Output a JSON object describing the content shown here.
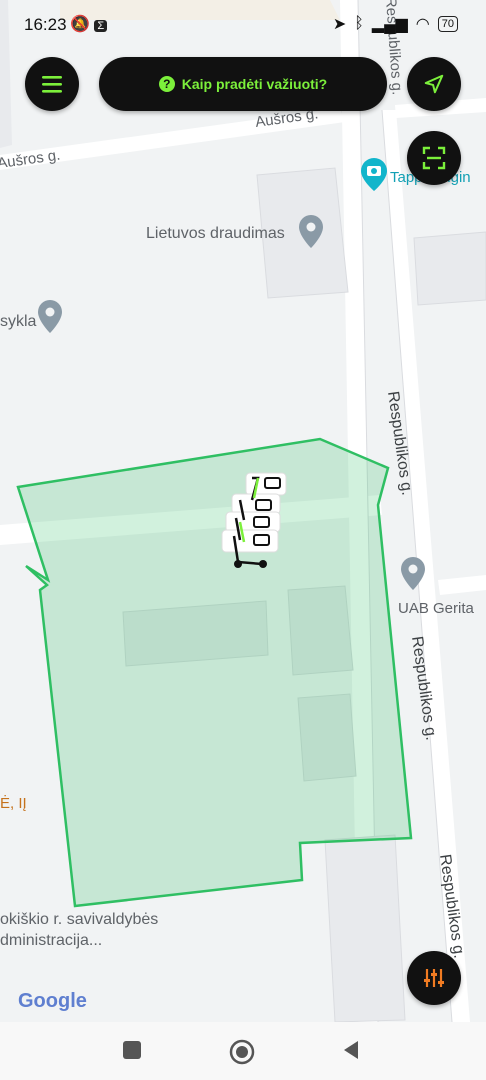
{
  "status_bar": {
    "time": "16:23",
    "battery": "70"
  },
  "header": {
    "help_label": "Kaip pradėti važiuoti?"
  },
  "map": {
    "streets": {
      "ausros_1": "Aušros g.",
      "ausros_2": "Aušros g.",
      "respublikos_top": "Respublikos g.",
      "respublikos_mid": "Respublikos g.",
      "respublikos_lower": "Respublikos g.",
      "respublikos_bottom": "Respublikos g."
    },
    "places": {
      "tapp": "Tapp Tangin",
      "lietuvos_draudimas": "Lietuvos draudimas",
      "sykla": "sykla",
      "uab_gerita": "UAB Gerita",
      "orange_label": "Ė, IĮ",
      "savivaldybe_line1": "okiškio r. savivaldybės",
      "savivaldybe_line2": "dministracija..."
    },
    "google_logo": "Google",
    "zone_color": "#2fbf63",
    "accent_color": "#7cf03b"
  },
  "icons": {
    "menu": "menu-icon",
    "help": "question-icon",
    "locate": "navigation-arrow-icon",
    "scan": "qr-scan-icon",
    "filter": "filter-sliders-icon",
    "nav_recent": "square-icon",
    "nav_home": "circle-icon",
    "nav_back": "triangle-back-icon"
  }
}
